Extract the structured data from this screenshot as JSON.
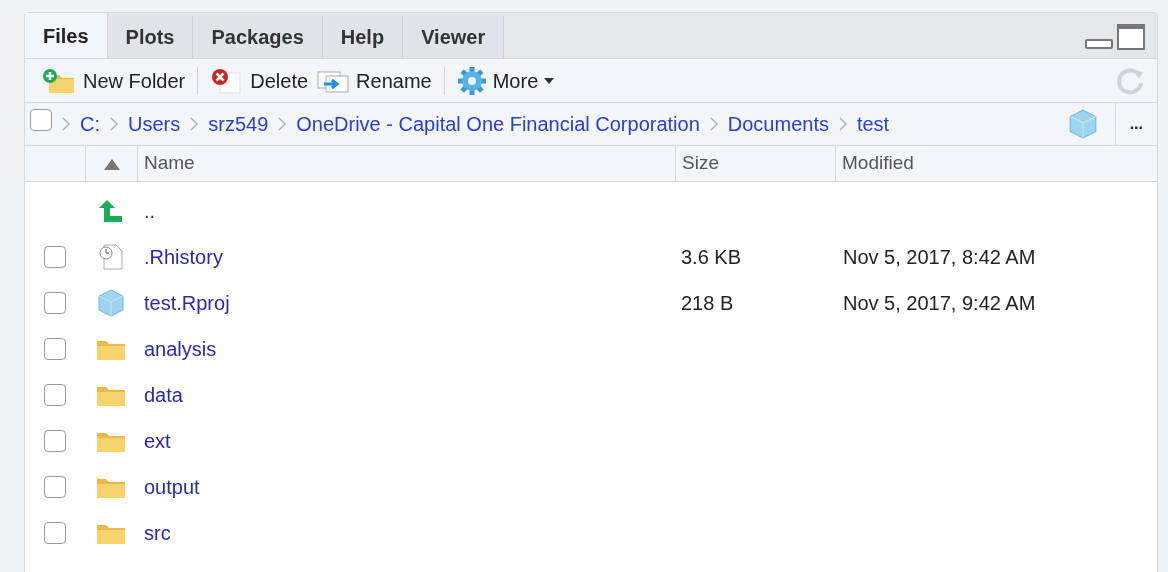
{
  "tabs": [
    {
      "label": "Files",
      "selected": true
    },
    {
      "label": "Plots",
      "selected": false
    },
    {
      "label": "Packages",
      "selected": false
    },
    {
      "label": "Help",
      "selected": false
    },
    {
      "label": "Viewer",
      "selected": false
    }
  ],
  "toolbar": [
    {
      "kind": "new-folder",
      "label": "New Folder"
    },
    {
      "kind": "delete",
      "label": "Delete"
    },
    {
      "kind": "rename",
      "label": "Rename"
    },
    {
      "kind": "more",
      "label": "More"
    }
  ],
  "breadcrumb": {
    "select_all_checked": false,
    "items": [
      "C:",
      "Users",
      "srz549",
      "OneDrive - Capital One Financial Corporation",
      "Documents",
      "test"
    ],
    "overflow": "..."
  },
  "table": {
    "sort_ascending": true,
    "columns": [
      "Name",
      "Size",
      "Modified"
    ],
    "rows": [
      {
        "kind": "parent",
        "name": ".."
      },
      {
        "kind": "file",
        "name": ".Rhistory",
        "size": "3.6 KB",
        "modified": "Nov 5, 2017, 8:42 AM",
        "checked": false
      },
      {
        "kind": "rproj",
        "name": "test.Rproj",
        "size": "218 B",
        "modified": "Nov 5, 2017, 9:42 AM",
        "checked": false
      },
      {
        "kind": "folder",
        "name": "analysis",
        "checked": false
      },
      {
        "kind": "folder",
        "name": "data",
        "checked": false
      },
      {
        "kind": "folder",
        "name": "ext",
        "checked": false
      },
      {
        "kind": "folder",
        "name": "output",
        "checked": false
      },
      {
        "kind": "folder",
        "name": "src",
        "checked": false
      }
    ]
  }
}
